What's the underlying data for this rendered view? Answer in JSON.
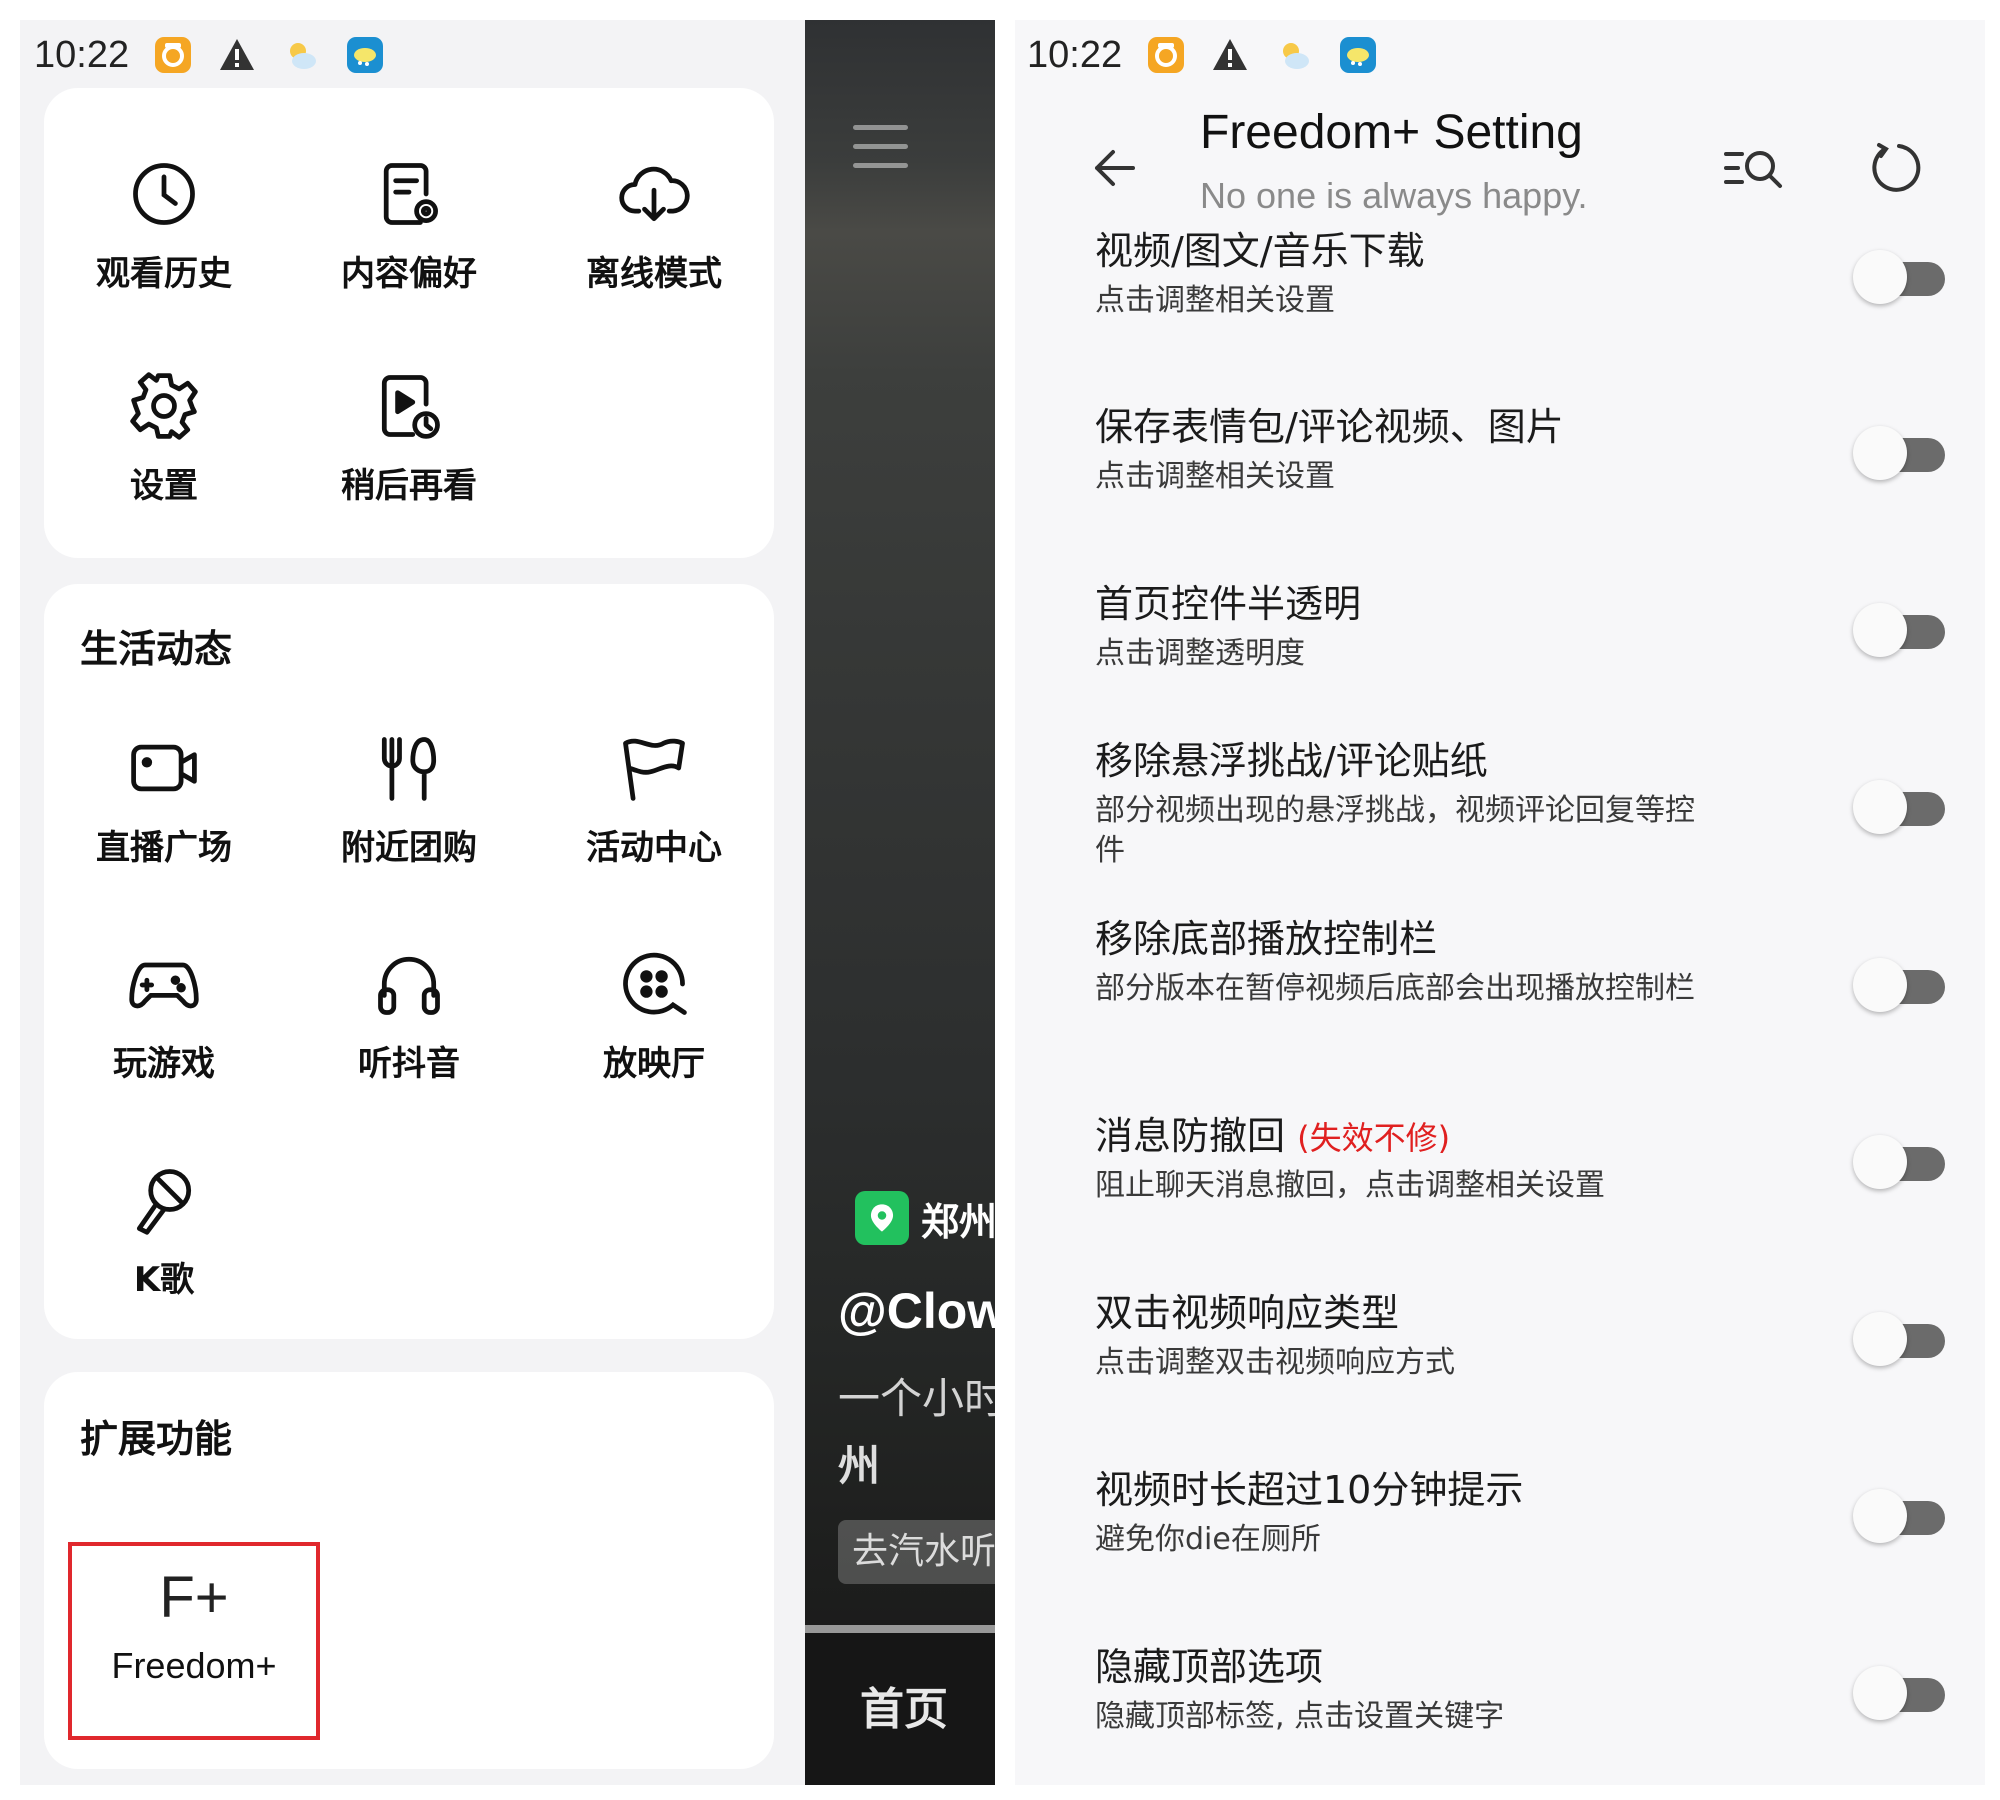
{
  "left": {
    "status_time": "10:22",
    "top_tiles": [
      {
        "icon": "clock-icon",
        "label": "观看历史"
      },
      {
        "icon": "document-settings-icon",
        "label": "内容偏好"
      },
      {
        "icon": "cloud-download-icon",
        "label": "离线模式"
      },
      {
        "icon": "gear-icon",
        "label": "设置"
      },
      {
        "icon": "watch-later-icon",
        "label": "稍后再看"
      }
    ],
    "life_section": {
      "title": "生活动态",
      "tiles": [
        {
          "icon": "live-camera-icon",
          "label": "直播广场"
        },
        {
          "icon": "fork-knife-icon",
          "label": "附近团购"
        },
        {
          "icon": "flag-icon",
          "label": "活动中心"
        },
        {
          "icon": "gamepad-icon",
          "label": "玩游戏"
        },
        {
          "icon": "headphones-icon",
          "label": "听抖音"
        },
        {
          "icon": "film-reel-icon",
          "label": "放映厅"
        },
        {
          "icon": "microphone-icon",
          "label": "K歌"
        }
      ]
    },
    "extension_section": {
      "title": "扩展功能",
      "freedom_logo": "F+",
      "freedom_label": "Freedom+"
    },
    "video": {
      "location": "郑州",
      "username": "@Clowr",
      "desc_line1": "一个小时",
      "desc_line2": "州",
      "chip": "去汽水听",
      "nav_home": "首页"
    }
  },
  "right": {
    "status_time": "10:22",
    "title": "Freedom+ Setting",
    "subtitle": "No one is always happy.",
    "settings": [
      {
        "title": "视频/图文/音乐下载",
        "tag": "",
        "subtitle": "点击调整相关设置",
        "enabled": false
      },
      {
        "title": "保存表情包/评论视频、图片",
        "tag": "",
        "subtitle": "点击调整相关设置",
        "enabled": false
      },
      {
        "title": "首页控件半透明",
        "tag": "",
        "subtitle": "点击调整透明度",
        "enabled": false
      },
      {
        "title": "移除悬浮挑战/评论贴纸",
        "tag": "",
        "subtitle": "部分视频出现的悬浮挑战，视频评论回复等控件",
        "enabled": false
      },
      {
        "title": "移除底部播放控制栏",
        "tag": "",
        "subtitle": "部分版本在暂停视频后底部会出现播放控制栏",
        "enabled": false
      },
      {
        "title": "消息防撤回",
        "tag": "(失效不修)",
        "subtitle": "阻止聊天消息撤回，点击调整相关设置",
        "enabled": false
      },
      {
        "title": "双击视频响应类型",
        "tag": "",
        "subtitle": "点击调整双击视频响应方式",
        "enabled": false
      },
      {
        "title": "视频时长超过10分钟提示",
        "tag": "",
        "subtitle": "避免你die在厕所",
        "enabled": false
      },
      {
        "title": "隐藏顶部选项",
        "tag": "",
        "subtitle": "隐藏顶部标签, 点击设置关键字",
        "enabled": false
      }
    ]
  },
  "colors": {
    "highlight_border": "#e0282d",
    "warning_tag": "#e02020",
    "toggle_track": "#6b6b6b",
    "location_pin": "#22c15e"
  }
}
